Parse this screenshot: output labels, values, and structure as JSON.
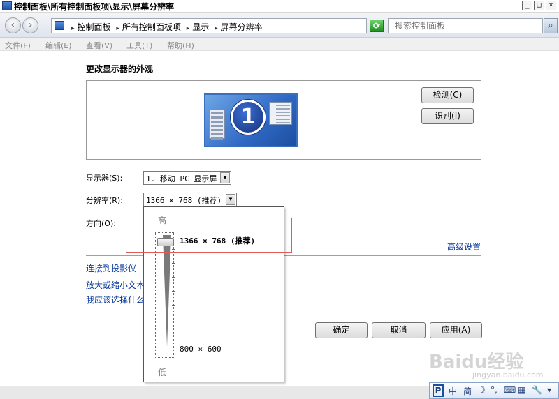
{
  "window": {
    "title": "控制面板\\所有控制面板项\\显示\\屏幕分辨率",
    "min_glyph": "_",
    "max_glyph": "□",
    "close_glyph": "×"
  },
  "nav": {
    "back_glyph": "‹",
    "forward_glyph": "›",
    "breadcrumbs": [
      "控制面板",
      "所有控制面板项",
      "显示",
      "屏幕分辨率"
    ],
    "separator_glyph": "▸",
    "dropdown_glyph": "▼",
    "refresh_glyph": "⟳",
    "search_placeholder": "搜索控制面板",
    "search_glyph": "⌕"
  },
  "menu": {
    "items": [
      "文件(F)",
      "编辑(E)",
      "查看(V)",
      "工具(T)",
      "帮助(H)"
    ]
  },
  "content": {
    "page_title": "更改显示器的外观",
    "monitor_number": "1",
    "detect_button": "检测(C)",
    "identify_button": "识别(I)",
    "display_label": "显示器(S):",
    "display_value": "1. 移动 PC 显示屏",
    "resolution_label": "分辨率(R):",
    "resolution_value": "1366 × 768 (推荐)",
    "orientation_label": "方向(O):",
    "advanced_link": "高级设置",
    "link_projector": "连接到投影仪",
    "link_text_size": "放大或缩小文本",
    "link_which": "我应该选择什么",
    "combo_arrow": "▼",
    "ok_button": "确定",
    "cancel_button": "取消",
    "apply_button": "应用(A)"
  },
  "resolution_popup": {
    "high_label": "高",
    "low_label": "低",
    "top_label": "1366 × 768 (推荐)",
    "bottom_label": "800 × 600",
    "slider_level": 1.0
  },
  "ime": {
    "logo": "P",
    "items": [
      "中",
      "简",
      "☽",
      "°,",
      "⌨",
      "▦",
      "🔧",
      "▾"
    ]
  },
  "watermark": {
    "text": "Baidu经验",
    "sub": "jingyan.baidu.com"
  }
}
